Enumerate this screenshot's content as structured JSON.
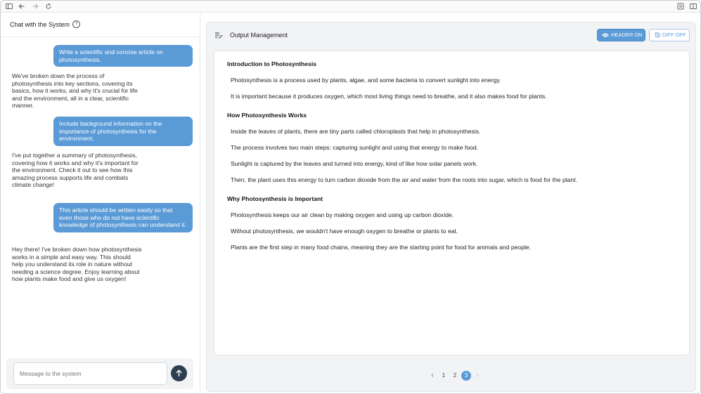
{
  "chat": {
    "title": "Chat with the System",
    "messages": [
      {
        "role": "user",
        "text": "Write a scientific and concise article on photosynthesis."
      },
      {
        "role": "system",
        "text": "We've broken down the process of photosynthesis into key sections, covering its basics, how it works, and why it's crucial for life and the environment, all in a clear, scientific manner."
      },
      {
        "role": "user",
        "text": "Include background information on the importance of photosynthesis for the environment."
      },
      {
        "role": "system",
        "text": "I've put together a summary of photosynthesis, covering how it works and why it's important for the environment. Check it out to see how this amazing process supports life and combats climate change!"
      },
      {
        "role": "user",
        "text": "This article should be written easily so that even those who do not have scientific knowledge of photosynthesis can understand it."
      },
      {
        "role": "system",
        "text": "Hey there! I've broken down how photosynthesis works in a simple and easy way. This should help you understand its role in nature without needing a science degree. Enjoy learning about how plants make food and give us oxygen!"
      }
    ],
    "input_placeholder": "Message to the system"
  },
  "output": {
    "title": "Output Management",
    "header_toggle_label": "HEADER ON",
    "diff_toggle_label": "DIFF OFF",
    "sections": [
      {
        "heading": "Introduction to Photosynthesis",
        "paragraphs": [
          "Photosynthesis is a process used by plants, algae, and some bacteria to convert sunlight into energy.",
          "It is important because it produces oxygen, which most living things need to breathe, and it also makes food for plants."
        ]
      },
      {
        "heading": "How Photosynthesis Works",
        "paragraphs": [
          "Inside the leaves of plants, there are tiny parts called chloroplasts that help in photosynthesis.",
          "The process involves two main steps: capturing sunlight and using that energy to make food.",
          "Sunlight is captured by the leaves and turned into energy, kind of like how solar panels work.",
          "Then, the plant uses this energy to turn carbon dioxide from the air and water from the roots into sugar, which is food for the plant."
        ]
      },
      {
        "heading": "Why Photosynthesis is Important",
        "paragraphs": [
          "Photosynthesis keeps our air clean by making oxygen and using up carbon dioxide.",
          "Without photosynthesis, we wouldn't have enough oxygen to breathe or plants to eat.",
          "Plants are the first step in many food chains, meaning they are the starting point for food for animals and people."
        ]
      }
    ],
    "pagination": {
      "pages": [
        "1",
        "2",
        "3"
      ],
      "current_page": "3",
      "prev_icon": "chevron-left-icon",
      "next_icon": "chevron-right-icon"
    }
  },
  "colors": {
    "accent": "#5a9ad6",
    "send_button": "#2c3e50"
  }
}
